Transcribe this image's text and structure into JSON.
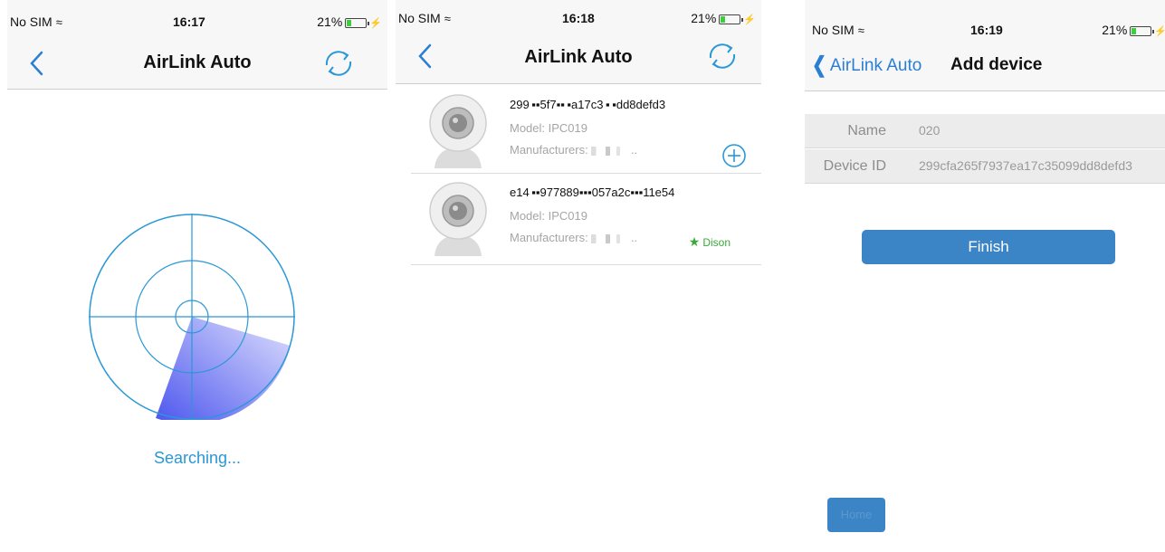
{
  "colors": {
    "accent": "#2a97d6",
    "button": "#3b85c6",
    "radar_sweep": "#5a66f0",
    "favorite": "#3aa83a"
  },
  "screens": [
    {
      "status": {
        "carrier": "No SIM",
        "time": "16:17",
        "battery": "21%"
      },
      "nav": {
        "title": "AirLink Auto",
        "back_icon": "chevron-left-icon",
        "refresh_icon": "refresh-icon"
      },
      "radar_icon": "radar-icon",
      "searching_text": "Searching..."
    },
    {
      "status": {
        "carrier": "No SIM",
        "time": "16:18",
        "battery": "21%"
      },
      "nav": {
        "title": "AirLink Auto",
        "back_icon": "chevron-left-icon",
        "refresh_icon": "refresh-icon"
      },
      "devices": [
        {
          "id": "299 ▪▪5f7▪▪ ▪a17c3 ▪ ▪dd8defd3",
          "model": "Model:  IPC019",
          "manufacturer": "Manufacturers:",
          "action_icon": "add-circle-icon"
        },
        {
          "id": "e14 ▪▪977889▪▪▪057a2c▪▪▪11e54",
          "model": "Model:  IPC019",
          "manufacturer": "Manufacturers:",
          "badge": "Dison",
          "badge_icon": "star-icon"
        }
      ]
    },
    {
      "status": {
        "carrier": "No SIM",
        "time": "16:19",
        "battery": "21%"
      },
      "nav": {
        "back_label": "AirLink Auto",
        "title": "Add device"
      },
      "form": {
        "name_label": "Name",
        "name_value": "020",
        "id_label": "Device ID",
        "id_value": "299cfa265f7937ea17c35099dd8defd3"
      },
      "finish_label": "Finish",
      "home_label": "Home"
    }
  ]
}
